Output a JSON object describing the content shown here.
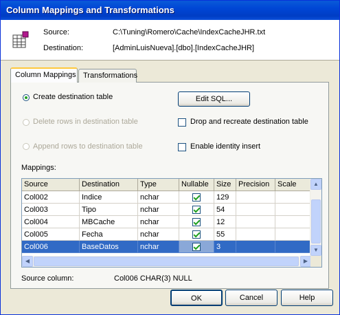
{
  "window": {
    "title": "Column Mappings and Transformations"
  },
  "header": {
    "source_label": "Source:",
    "source_value": "C:\\Tuning\\Romero\\Cache\\IndexCacheJHR.txt",
    "destination_label": "Destination:",
    "destination_value": "[AdminLuisNueva].[dbo].[IndexCacheJHR]",
    "icon": "table-icon"
  },
  "tabs": [
    {
      "label": "Column Mappings",
      "active": true
    },
    {
      "label": "Transformations",
      "active": false
    }
  ],
  "options": {
    "create_table": {
      "label": "Create destination table",
      "selected": true,
      "enabled": true
    },
    "delete_rows": {
      "label": "Delete rows in destination table",
      "selected": false,
      "enabled": false
    },
    "append_rows": {
      "label": "Append rows to destination table",
      "selected": false,
      "enabled": false
    },
    "edit_sql_label": "Edit SQL...",
    "drop_recreate": {
      "label": "Drop and recreate destination table",
      "checked": false
    },
    "identity_insert": {
      "label": "Enable identity insert",
      "checked": false
    }
  },
  "mappings": {
    "label": "Mappings:",
    "columns": [
      "Source",
      "Destination",
      "Type",
      "Nullable",
      "Size",
      "Precision",
      "Scale"
    ],
    "rows": [
      {
        "source": "Col002",
        "destination": "Indice",
        "type": "nchar",
        "nullable": true,
        "size": "129",
        "precision": "",
        "scale": "",
        "selected": false
      },
      {
        "source": "Col003",
        "destination": "Tipo",
        "type": "nchar",
        "nullable": true,
        "size": "54",
        "precision": "",
        "scale": "",
        "selected": false
      },
      {
        "source": "Col004",
        "destination": "MBCache",
        "type": "nchar",
        "nullable": true,
        "size": "12",
        "precision": "",
        "scale": "",
        "selected": false
      },
      {
        "source": "Col005",
        "destination": "Fecha",
        "type": "nchar",
        "nullable": true,
        "size": "55",
        "precision": "",
        "scale": "",
        "selected": false
      },
      {
        "source": "Col006",
        "destination": "BaseDatos",
        "type": "nchar",
        "nullable": true,
        "size": "3",
        "precision": "",
        "scale": "",
        "selected": true
      }
    ]
  },
  "source_column": {
    "label": "Source column:",
    "value": "Col006 CHAR(3) NULL"
  },
  "buttons": {
    "ok": "OK",
    "cancel": "Cancel",
    "help": "Help"
  },
  "colors": {
    "titlebar": "#0046d5",
    "selection": "#316ac5",
    "dialog_bg": "#ece9d8"
  }
}
